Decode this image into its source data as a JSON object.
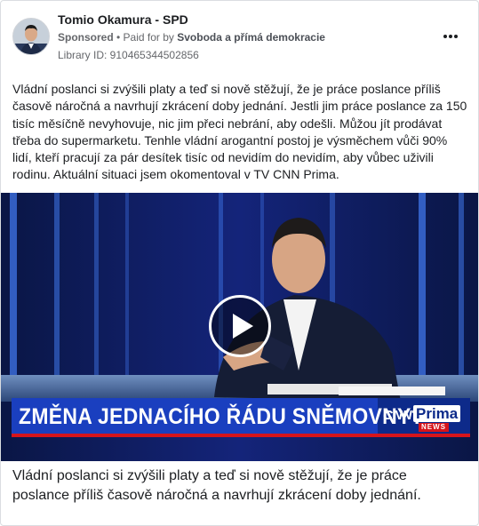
{
  "post": {
    "page_name": "Tomio Okamura - SPD",
    "sponsored_label": "Sponsored",
    "separator": " • ",
    "paid_for_prefix": "Paid for by ",
    "payer": "Svoboda a přímá demokracie",
    "library_id": "Library ID: 910465344502856",
    "more_icon": "more-horizontal-icon",
    "body_text": "Vládní poslanci si zvýšili platy a teď si nově stěžují, že je práce poslance příliš časově náročná a navrhují zkrácení doby jednání. Jestli jim práce poslance za 150 tisíc měsíčně nevyhovuje, nic jim přeci nebrání, aby odešli. Můžou jít prodávat třeba do supermarketu. Tenhle vládní arogantní postoj je výsměchem vůči 90% lidí, kteří pracují za pár desítek tisíc od nevidím do nevidím, aby vůbec uživili rodinu. Aktuální situaci jsem okomentoval v TV CNN Prima.",
    "video": {
      "tv_caption": "ZMĚNA JEDNACÍHO ŘÁDU SNĚMOVNY?",
      "channel_logo_cnn": "CNN",
      "channel_logo_prima": "Prima",
      "channel_logo_news": "NEWS",
      "play_icon": "play-icon"
    },
    "caption_text": "Vládní poslanci si zvýšili platy a teď si nově stěžují, že je práce poslance příliš časově náročná a navrhují zkrácení doby jednání."
  },
  "colors": {
    "text_primary": "#1c1e21",
    "text_secondary": "#65676b",
    "border": "#dadde1",
    "tv_caption_bar": "#1a3fbf",
    "studio_blue": "#0c1a52"
  }
}
